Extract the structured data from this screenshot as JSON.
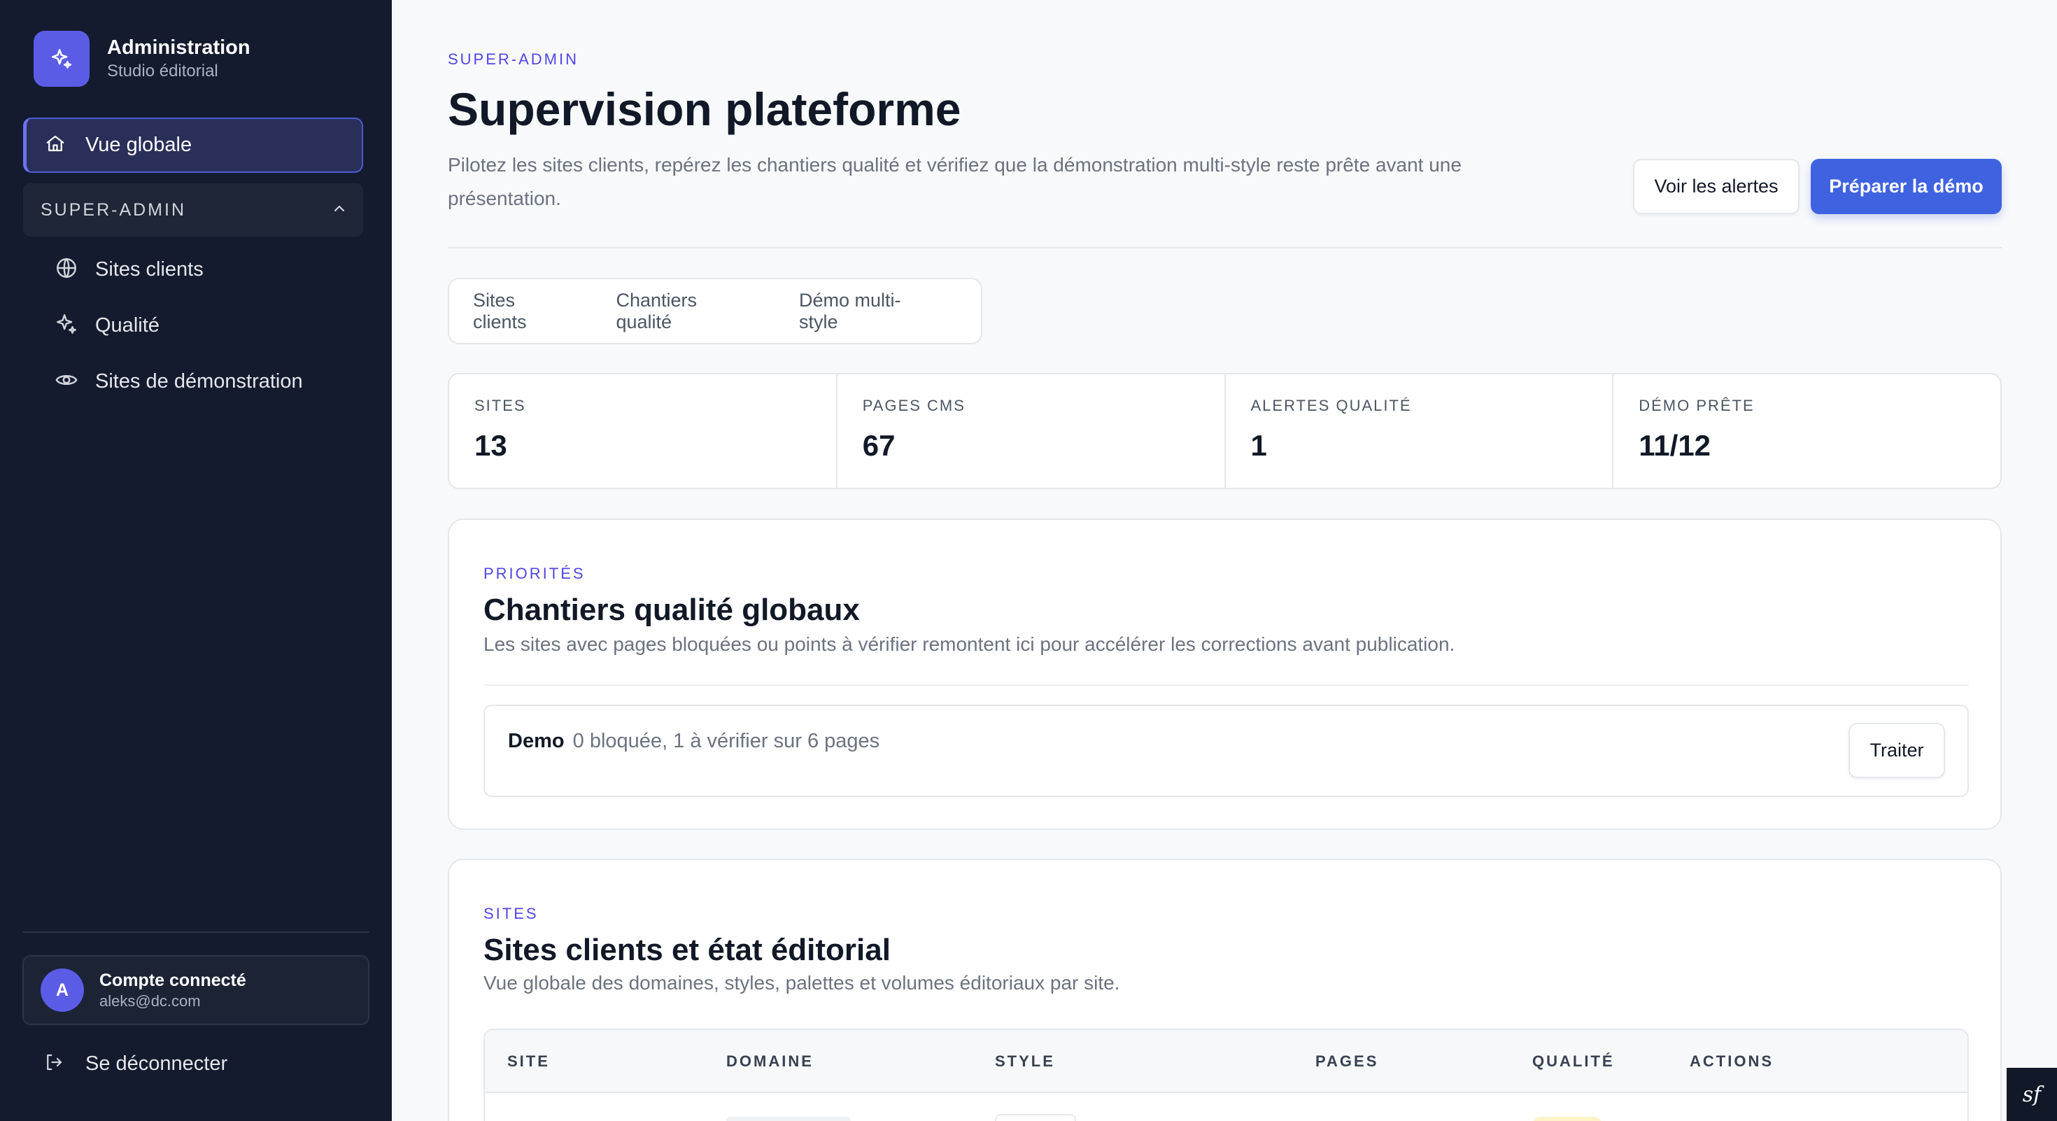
{
  "sidebar": {
    "brand": {
      "title": "Administration",
      "subtitle": "Studio éditorial",
      "icon": "sparkle-icon"
    },
    "nav_active": {
      "label": "Vue globale",
      "icon": "home-icon"
    },
    "group": {
      "label": "SUPER-ADMIN",
      "icon": "chevron-up-icon",
      "expanded": true
    },
    "items": [
      {
        "label": "Sites clients",
        "icon": "globe-icon"
      },
      {
        "label": "Qualité",
        "icon": "sparkle-icon"
      },
      {
        "label": "Sites de démonstration",
        "icon": "eye-icon"
      }
    ],
    "account": {
      "initial": "A",
      "name": "Compte connecté",
      "email": "aleks@dc.com"
    },
    "logout": {
      "label": "Se déconnecter",
      "icon": "logout-icon"
    }
  },
  "header": {
    "eyebrow": "SUPER-ADMIN",
    "title": "Supervision plateforme",
    "description": "Pilotez les sites clients, repérez les chantiers qualité et vérifiez que la démonstration multi-style reste prête avant une présentation.",
    "secondary_button": "Voir les alertes",
    "primary_button": "Préparer la démo"
  },
  "tabs": [
    "Sites clients",
    "Chantiers qualité",
    "Démo multi-style"
  ],
  "stats": [
    {
      "label": "SITES",
      "value": "13"
    },
    {
      "label": "PAGES CMS",
      "value": "67"
    },
    {
      "label": "ALERTES QUALITÉ",
      "value": "1"
    },
    {
      "label": "DÉMO PRÊTE",
      "value": "11/12"
    }
  ],
  "priorities": {
    "eyebrow": "PRIORITÉS",
    "title": "Chantiers qualité globaux",
    "description": "Les sites avec pages bloquées ou points à vérifier remontent ici pour accélérer les corrections avant publication.",
    "items": [
      {
        "name": "Demo",
        "info": "0 bloquée, 1 à vérifier sur 6 pages",
        "action": "Traiter"
      }
    ]
  },
  "sites": {
    "eyebrow": "SITES",
    "title": "Sites clients et état éditorial",
    "description": "Vue globale des domaines, styles, palettes et volumes éditoriaux par site.",
    "columns": [
      "SITE",
      "DOMAINE",
      "STYLE",
      "PAGES",
      "QUALITÉ",
      "ACTIONS"
    ]
  },
  "colors": {
    "sidebar_bg": "#141b2e",
    "accent": "#5b5ce6",
    "primary_button": "#3f63e0",
    "eyebrow": "#4f46e5"
  }
}
